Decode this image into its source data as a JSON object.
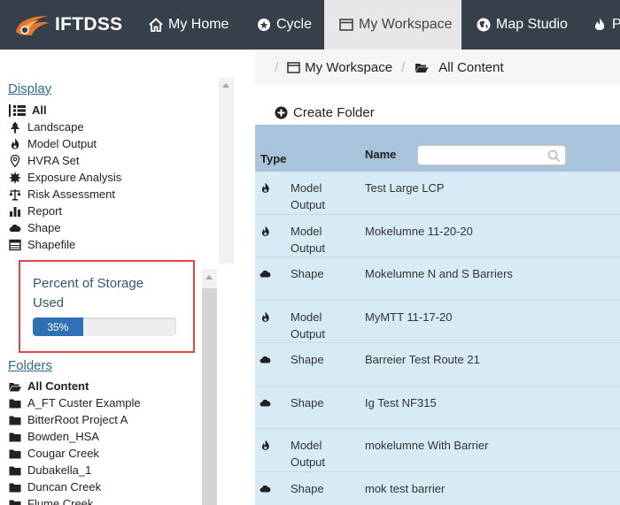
{
  "app": {
    "brand": "IFTDSS"
  },
  "topnav": {
    "items": [
      {
        "label": "My Home",
        "icon": "home-icon"
      },
      {
        "label": "Cycle",
        "icon": "cycle-icon"
      },
      {
        "label": "My Workspace",
        "icon": "workspace-window-icon",
        "active": true
      },
      {
        "label": "Map Studio",
        "icon": "globe-icon"
      },
      {
        "label": "Pl",
        "icon": "fire-icon"
      }
    ]
  },
  "sidebar": {
    "display_title": "Display",
    "display_items": [
      {
        "label": "All",
        "icon": "list-icon",
        "active": true
      },
      {
        "label": "Landscape",
        "icon": "tree-icon"
      },
      {
        "label": "Model Output",
        "icon": "model-output-icon"
      },
      {
        "label": "HVRA Set",
        "icon": "map-marker-icon"
      },
      {
        "label": "Exposure Analysis",
        "icon": "sun-burst-icon"
      },
      {
        "label": "Risk Assessment",
        "icon": "balance-scale-icon"
      },
      {
        "label": "Report",
        "icon": "bar-chart-icon"
      },
      {
        "label": "Shape",
        "icon": "cloud-icon"
      },
      {
        "label": "Shapefile",
        "icon": "table-icon"
      }
    ],
    "storage": {
      "title": "Percent of Storage Used",
      "percent_label": "35%",
      "fraction": 0.35,
      "bar_color": "#2f70b5"
    },
    "folders_title": "Folders",
    "folders": [
      {
        "label": "All Content",
        "icon": "folder-open-icon",
        "active": true
      },
      {
        "label": "A_FT Custer Example",
        "icon": "folder-icon"
      },
      {
        "label": "BitterRoot Project A",
        "icon": "folder-icon"
      },
      {
        "label": "Bowden_HSA",
        "icon": "folder-icon"
      },
      {
        "label": "Cougar Creek",
        "icon": "folder-icon"
      },
      {
        "label": "Dubakella_1",
        "icon": "folder-icon"
      },
      {
        "label": "Duncan Creek",
        "icon": "folder-icon"
      },
      {
        "label": "Flume Creek",
        "icon": "folder-icon"
      }
    ]
  },
  "breadcrumb": {
    "sep": "/",
    "items": [
      "My Workspace",
      "All Content"
    ]
  },
  "content": {
    "create_folder_label": "Create Folder",
    "table": {
      "headers": {
        "type": "Type",
        "name": "Name"
      },
      "name_filter_value": "",
      "rows": [
        {
          "type": "Model Output",
          "name": "Test Large LCP",
          "icon": "model-output-icon"
        },
        {
          "type": "Model Output",
          "name": "Mokelumne 11-20-20",
          "icon": "model-output-icon"
        },
        {
          "type": "Shape",
          "name": "Mokelumne N and S Barriers",
          "icon": "cloud-icon"
        },
        {
          "type": "Model Output",
          "name": "MyMTT 11-17-20",
          "icon": "model-output-icon"
        },
        {
          "type": "Shape",
          "name": "Barreier Test Route 21",
          "icon": "cloud-icon"
        },
        {
          "type": "Shape",
          "name": "Ig Test NF315",
          "icon": "cloud-icon"
        },
        {
          "type": "Model Output",
          "name": "mokelumne With Barrier",
          "icon": "model-output-icon"
        },
        {
          "type": "Shape",
          "name": "mok test barrier",
          "icon": "cloud-icon"
        }
      ]
    }
  },
  "colors": {
    "nav_bg": "#36404a",
    "nav_active_bg": "#e7e7e7",
    "link": "#2f6b8a",
    "table_header_bg": "#a9c3dc",
    "table_row_bg": "#d6ebf4",
    "highlight_border": "#e04848"
  }
}
